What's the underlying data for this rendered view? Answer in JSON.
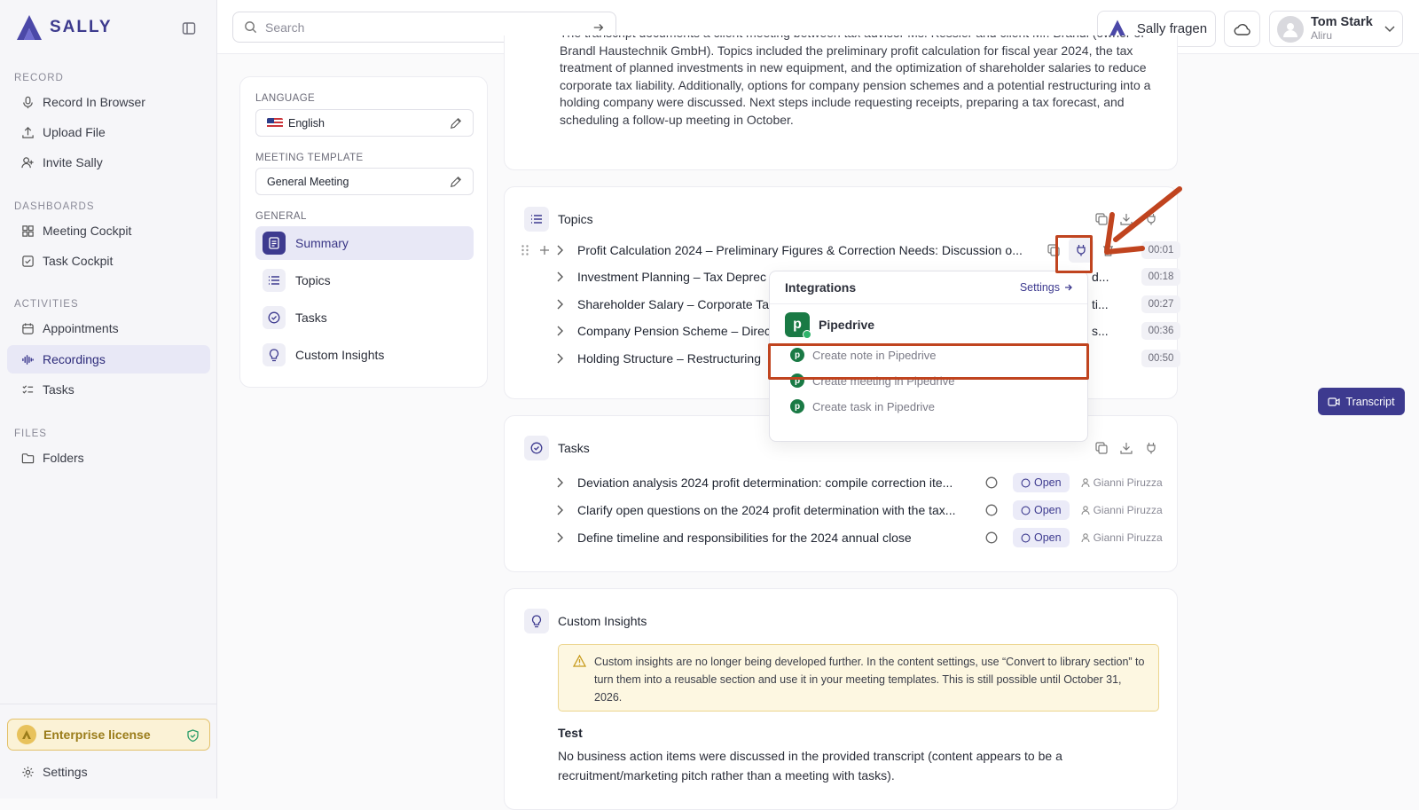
{
  "app": {
    "logo_text": "SALLY"
  },
  "search": {
    "placeholder": "Search"
  },
  "header": {
    "ask_label": "Sally fragen",
    "user_name": "Tom Stark",
    "user_org": "Aliru"
  },
  "sidebar": {
    "record_label": "RECORD",
    "record_items": [
      "Record In Browser",
      "Upload File",
      "Invite Sally"
    ],
    "dashboards_label": "DASHBOARDS",
    "dashboard_items": [
      "Meeting Cockpit",
      "Task Cockpit"
    ],
    "activities_label": "ACTIVITIES",
    "activity_items": [
      "Appointments",
      "Recordings",
      "Tasks"
    ],
    "files_label": "FILES",
    "file_items": [
      "Folders"
    ],
    "license": "Enterprise license",
    "settings": "Settings"
  },
  "panel": {
    "language_label": "LANGUAGE",
    "language_value": "English",
    "template_label": "MEETING TEMPLATE",
    "template_value": "General Meeting",
    "general_label": "GENERAL",
    "general_items": [
      "Summary",
      "Topics",
      "Tasks",
      "Custom Insights"
    ]
  },
  "summary": {
    "text": "The transcript documents a client meeting between tax advisor Ms. Kessler and client Mr. Brandl (owner of Brandl Haustechnik GmbH). Topics included the preliminary profit calculation for fiscal year 2024, the tax treatment of planned investments in new equipment, and the optimization of shareholder salaries to reduce corporate tax liability. Additionally, options for company pension schemes and a potential restructuring into a holding company were discussed. Next steps include requesting receipts, preparing a tax forecast, and scheduling a follow-up meeting in October."
  },
  "topics": {
    "title": "Topics",
    "rows": [
      {
        "text": "Profit Calculation 2024 – Preliminary Figures & Correction Needs: Discussion o...",
        "time": "00:01"
      },
      {
        "text": "Investment Planning – Tax Deprec",
        "tail": "d...",
        "time": "00:18"
      },
      {
        "text": "Shareholder Salary – Corporate Ta",
        "tail": "ti...",
        "time": "00:27"
      },
      {
        "text": "Company Pension Scheme – Direc",
        "tail": "s...",
        "time": "00:36"
      },
      {
        "text": "Holding Structure – Restructuring",
        "tail": "",
        "time": "00:50"
      }
    ]
  },
  "integrations": {
    "title": "Integrations",
    "settings": "Settings",
    "provider": "Pipedrive",
    "actions": [
      "Create note in Pipedrive",
      "Create meeting in Pipedrive",
      "Create task in Pipedrive"
    ]
  },
  "tasks": {
    "title": "Tasks",
    "rows": [
      {
        "text": "Deviation analysis 2024 profit determination: compile correction ite...",
        "status": "Open",
        "assignee": "Gianni Piruzza"
      },
      {
        "text": "Clarify open questions on the 2024 profit determination with the tax...",
        "status": "Open",
        "assignee": "Gianni Piruzza"
      },
      {
        "text": "Define timeline and responsibilities for the 2024 annual close",
        "status": "Open",
        "assignee": "Gianni Piruzza"
      }
    ]
  },
  "insights": {
    "title": "Custom Insights",
    "warning": "Custom insights are no longer being developed further. In the content settings, use “Convert to library section” to turn them into a reusable section and use it in your meeting templates. This is still possible until October 31, 2026.",
    "item_title": "Test",
    "item_text": "No business action items were discussed in the provided transcript (content appears to be a recruitment/marketing pitch rather than a meeting with tasks)."
  },
  "transcript_button": "Transcript",
  "colors": {
    "brand": "#3d3a8f",
    "annotation": "#c0441f",
    "pipedrive": "#1a7a45"
  }
}
